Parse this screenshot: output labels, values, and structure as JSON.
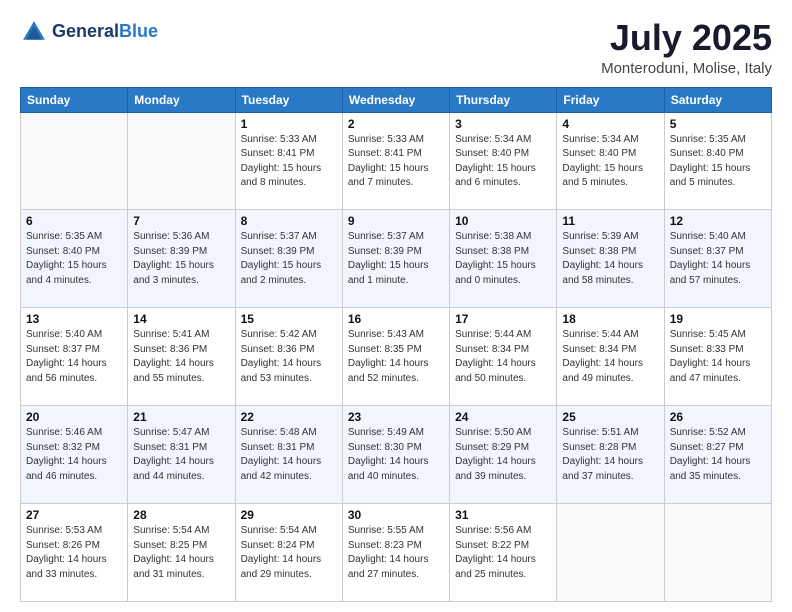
{
  "header": {
    "logo_line1": "General",
    "logo_line2": "Blue",
    "title": "July 2025",
    "subtitle": "Monteroduni, Molise, Italy"
  },
  "weekdays": [
    "Sunday",
    "Monday",
    "Tuesday",
    "Wednesday",
    "Thursday",
    "Friday",
    "Saturday"
  ],
  "weeks": [
    [
      {
        "day": "",
        "info": ""
      },
      {
        "day": "",
        "info": ""
      },
      {
        "day": "1",
        "info": "Sunrise: 5:33 AM\nSunset: 8:41 PM\nDaylight: 15 hours\nand 8 minutes."
      },
      {
        "day": "2",
        "info": "Sunrise: 5:33 AM\nSunset: 8:41 PM\nDaylight: 15 hours\nand 7 minutes."
      },
      {
        "day": "3",
        "info": "Sunrise: 5:34 AM\nSunset: 8:40 PM\nDaylight: 15 hours\nand 6 minutes."
      },
      {
        "day": "4",
        "info": "Sunrise: 5:34 AM\nSunset: 8:40 PM\nDaylight: 15 hours\nand 5 minutes."
      },
      {
        "day": "5",
        "info": "Sunrise: 5:35 AM\nSunset: 8:40 PM\nDaylight: 15 hours\nand 5 minutes."
      }
    ],
    [
      {
        "day": "6",
        "info": "Sunrise: 5:35 AM\nSunset: 8:40 PM\nDaylight: 15 hours\nand 4 minutes."
      },
      {
        "day": "7",
        "info": "Sunrise: 5:36 AM\nSunset: 8:39 PM\nDaylight: 15 hours\nand 3 minutes."
      },
      {
        "day": "8",
        "info": "Sunrise: 5:37 AM\nSunset: 8:39 PM\nDaylight: 15 hours\nand 2 minutes."
      },
      {
        "day": "9",
        "info": "Sunrise: 5:37 AM\nSunset: 8:39 PM\nDaylight: 15 hours\nand 1 minute."
      },
      {
        "day": "10",
        "info": "Sunrise: 5:38 AM\nSunset: 8:38 PM\nDaylight: 15 hours\nand 0 minutes."
      },
      {
        "day": "11",
        "info": "Sunrise: 5:39 AM\nSunset: 8:38 PM\nDaylight: 14 hours\nand 58 minutes."
      },
      {
        "day": "12",
        "info": "Sunrise: 5:40 AM\nSunset: 8:37 PM\nDaylight: 14 hours\nand 57 minutes."
      }
    ],
    [
      {
        "day": "13",
        "info": "Sunrise: 5:40 AM\nSunset: 8:37 PM\nDaylight: 14 hours\nand 56 minutes."
      },
      {
        "day": "14",
        "info": "Sunrise: 5:41 AM\nSunset: 8:36 PM\nDaylight: 14 hours\nand 55 minutes."
      },
      {
        "day": "15",
        "info": "Sunrise: 5:42 AM\nSunset: 8:36 PM\nDaylight: 14 hours\nand 53 minutes."
      },
      {
        "day": "16",
        "info": "Sunrise: 5:43 AM\nSunset: 8:35 PM\nDaylight: 14 hours\nand 52 minutes."
      },
      {
        "day": "17",
        "info": "Sunrise: 5:44 AM\nSunset: 8:34 PM\nDaylight: 14 hours\nand 50 minutes."
      },
      {
        "day": "18",
        "info": "Sunrise: 5:44 AM\nSunset: 8:34 PM\nDaylight: 14 hours\nand 49 minutes."
      },
      {
        "day": "19",
        "info": "Sunrise: 5:45 AM\nSunset: 8:33 PM\nDaylight: 14 hours\nand 47 minutes."
      }
    ],
    [
      {
        "day": "20",
        "info": "Sunrise: 5:46 AM\nSunset: 8:32 PM\nDaylight: 14 hours\nand 46 minutes."
      },
      {
        "day": "21",
        "info": "Sunrise: 5:47 AM\nSunset: 8:31 PM\nDaylight: 14 hours\nand 44 minutes."
      },
      {
        "day": "22",
        "info": "Sunrise: 5:48 AM\nSunset: 8:31 PM\nDaylight: 14 hours\nand 42 minutes."
      },
      {
        "day": "23",
        "info": "Sunrise: 5:49 AM\nSunset: 8:30 PM\nDaylight: 14 hours\nand 40 minutes."
      },
      {
        "day": "24",
        "info": "Sunrise: 5:50 AM\nSunset: 8:29 PM\nDaylight: 14 hours\nand 39 minutes."
      },
      {
        "day": "25",
        "info": "Sunrise: 5:51 AM\nSunset: 8:28 PM\nDaylight: 14 hours\nand 37 minutes."
      },
      {
        "day": "26",
        "info": "Sunrise: 5:52 AM\nSunset: 8:27 PM\nDaylight: 14 hours\nand 35 minutes."
      }
    ],
    [
      {
        "day": "27",
        "info": "Sunrise: 5:53 AM\nSunset: 8:26 PM\nDaylight: 14 hours\nand 33 minutes."
      },
      {
        "day": "28",
        "info": "Sunrise: 5:54 AM\nSunset: 8:25 PM\nDaylight: 14 hours\nand 31 minutes."
      },
      {
        "day": "29",
        "info": "Sunrise: 5:54 AM\nSunset: 8:24 PM\nDaylight: 14 hours\nand 29 minutes."
      },
      {
        "day": "30",
        "info": "Sunrise: 5:55 AM\nSunset: 8:23 PM\nDaylight: 14 hours\nand 27 minutes."
      },
      {
        "day": "31",
        "info": "Sunrise: 5:56 AM\nSunset: 8:22 PM\nDaylight: 14 hours\nand 25 minutes."
      },
      {
        "day": "",
        "info": ""
      },
      {
        "day": "",
        "info": ""
      }
    ]
  ]
}
